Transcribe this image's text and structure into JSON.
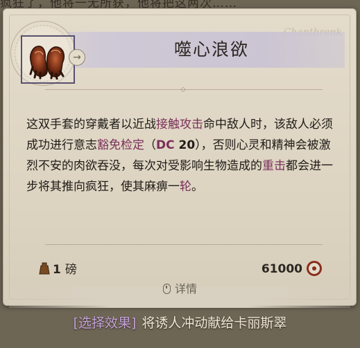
{
  "background_text": "疯狂了，他将一无所获，他将把这两次……",
  "item": {
    "name": "噬心浪欲",
    "signature": "Chanthrenk",
    "description": {
      "p1": "这双手套的穿戴者以近战",
      "kw1": "接触攻击",
      "p2": "命中敌人时，该敌人必须成功进行意志",
      "kw2": "豁免检定",
      "p3": "（",
      "kw3": "DC",
      "num": " 20",
      "p4": "），否则心灵和精神会被激烈不安的肉欲吞没，每次对受影响生物造成的",
      "kw4": "重击",
      "p5": "都会进一步将其推向疯狂，使其麻痹一",
      "kw5": "轮",
      "p6": "。"
    },
    "weight_value": "1",
    "weight_unit": "磅",
    "price": "61000",
    "details_label": "详情"
  },
  "action": {
    "select_label": "[选择效果]",
    "text": "将诱人冲动献给卡丽斯翠"
  },
  "colors": {
    "keyword": "#7a2f5a",
    "selector": "#c4a0d8",
    "coin": "#8a2d1c",
    "icon_frame": "#57506d"
  },
  "icons": [
    "gloves-icon",
    "arrow-icon",
    "weight-icon",
    "coin-icon",
    "mouse-icon"
  ]
}
